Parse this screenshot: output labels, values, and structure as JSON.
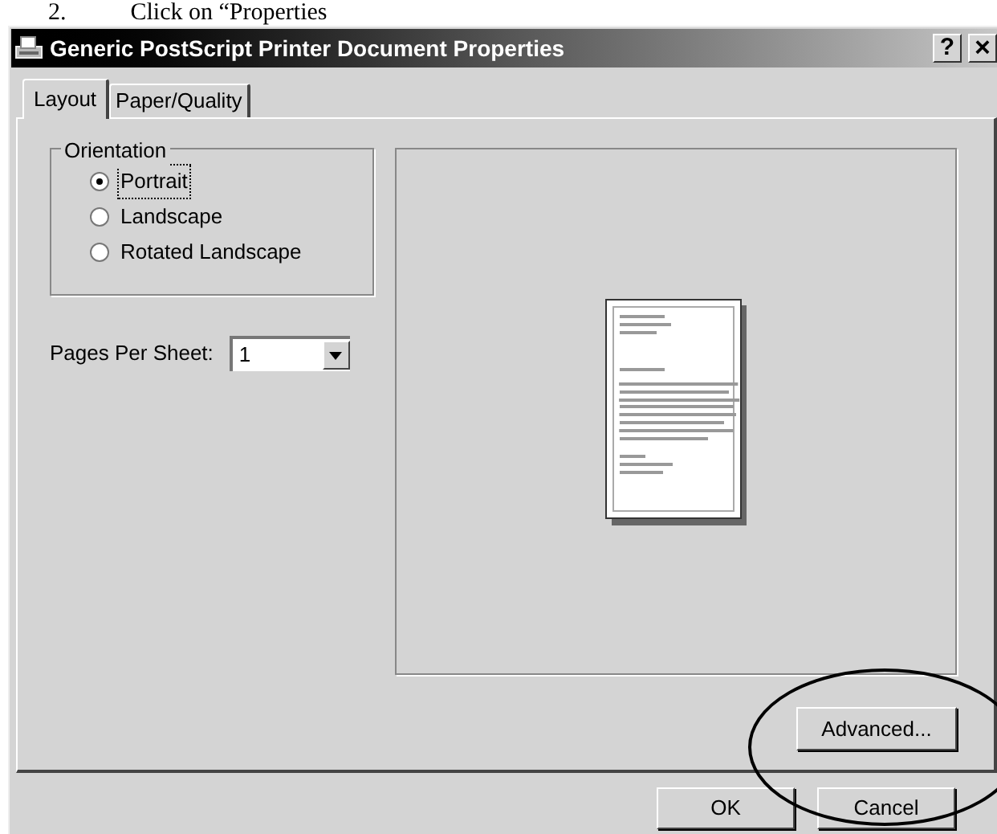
{
  "document": {
    "step_number": "2.",
    "step_text": "Click on “Properties"
  },
  "window": {
    "title": "Generic PostScript Printer Document Properties",
    "buttons": [
      {
        "kind": "help",
        "label": "?"
      },
      {
        "kind": "close",
        "label": "×"
      }
    ]
  },
  "tabs": [
    {
      "label": "Layout",
      "selected": true
    },
    {
      "label": "Paper/Quality",
      "selected": false
    }
  ],
  "orientation": {
    "label": "Orientation",
    "options": [
      {
        "label": "Portrait",
        "selected": true,
        "focused": true
      },
      {
        "label": "Landscape",
        "selected": false,
        "focused": false
      },
      {
        "label": "Rotated Landscape",
        "selected": false,
        "focused": false
      }
    ]
  },
  "pages_per_sheet": {
    "label": "Pages Per Sheet:",
    "value": "1"
  },
  "advanced_button": "Advanced...",
  "buttons": [
    "OK",
    "Cancel"
  ]
}
